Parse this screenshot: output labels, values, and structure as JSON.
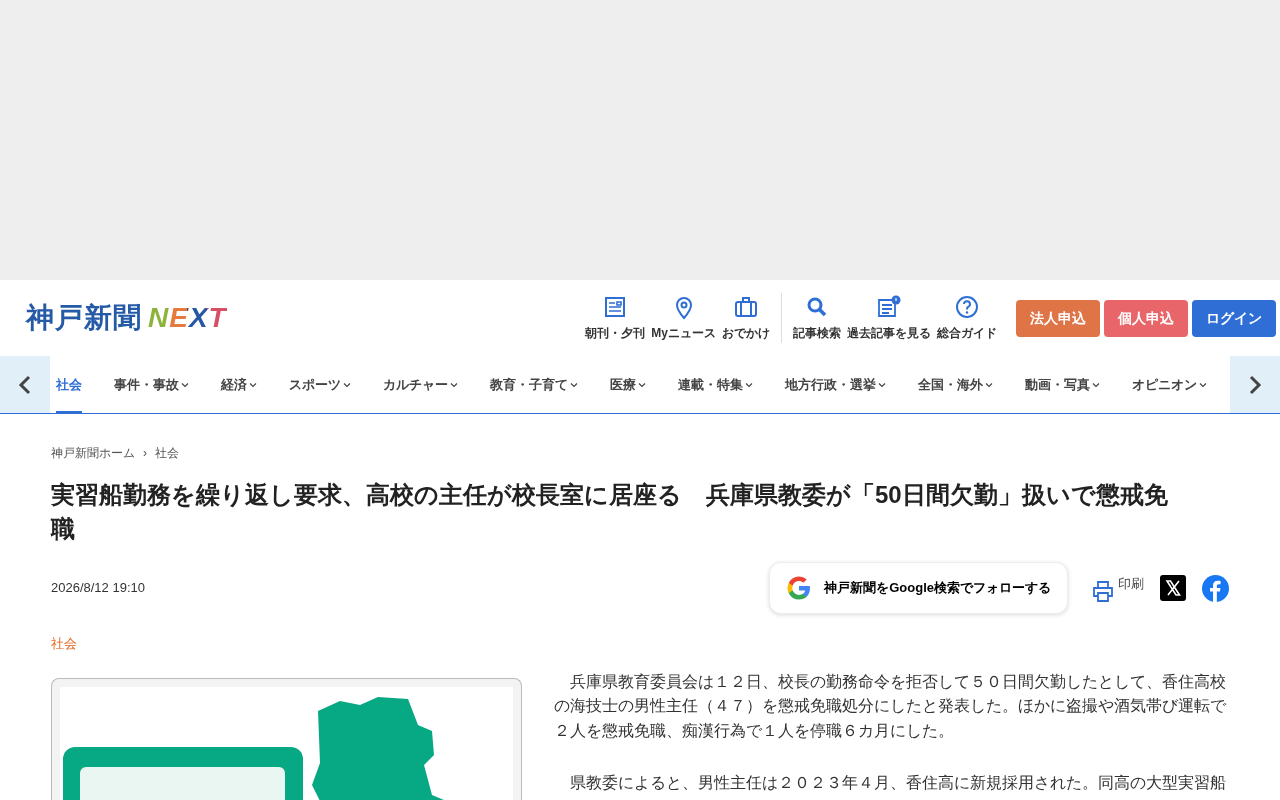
{
  "header": {
    "logo": {
      "text": "神戸新聞",
      "accent": "NEXT"
    },
    "tool_groups": [
      [
        {
          "label": "朝刊・夕刊",
          "kind": "newspaper"
        },
        {
          "label": "Myニュース",
          "kind": "pin"
        },
        {
          "label": "おでかけ",
          "kind": "suitcase"
        }
      ],
      [
        {
          "label": "記事検索",
          "kind": "search"
        },
        {
          "label": "過去記事を見る",
          "kind": "archive"
        },
        {
          "label": "総合ガイド",
          "kind": "help"
        }
      ]
    ],
    "buttons": [
      {
        "label": "法人申込",
        "color": "#df7447"
      },
      {
        "label": "個人申込",
        "color": "#e8666a"
      },
      {
        "label": "ログイン",
        "color": "#2f6fd5"
      }
    ]
  },
  "nav": [
    {
      "label": "社会",
      "selected": true,
      "dropdown": false
    },
    {
      "label": "事件・事故",
      "selected": false,
      "dropdown": true
    },
    {
      "label": "経済",
      "selected": false,
      "dropdown": true
    },
    {
      "label": "スポーツ",
      "selected": false,
      "dropdown": true
    },
    {
      "label": "カルチャー",
      "selected": false,
      "dropdown": true
    },
    {
      "label": "教育・子育て",
      "selected": false,
      "dropdown": true
    },
    {
      "label": "医療",
      "selected": false,
      "dropdown": true
    },
    {
      "label": "連載・特集",
      "selected": false,
      "dropdown": true
    },
    {
      "label": "地方行政・選挙",
      "selected": false,
      "dropdown": true
    },
    {
      "label": "全国・海外",
      "selected": false,
      "dropdown": true
    },
    {
      "label": "動画・写真",
      "selected": false,
      "dropdown": true
    },
    {
      "label": "オピニオン",
      "selected": false,
      "dropdown": true
    }
  ],
  "breadcrumb": {
    "items": [
      "神戸新聞ホーム",
      "社会"
    ],
    "separator": "›"
  },
  "article": {
    "title": "実習船勤務を繰り返し要求、高校の主任が校長室に居座る　兵庫県教委が「50日間欠勤」扱いで懲戒免職",
    "date": "2026/8/12 19:10",
    "follow_button": "神戸新聞をGoogle検索でフォローする",
    "print": "印刷",
    "category": "社会",
    "image": {
      "kind": "picture"
    },
    "paragraphs": [
      "兵庫県教育委員会は１２日、校長の勤務命令を拒否して５０日間欠勤したとして、香住高校の海技士の男性主任（４７）を懲戒免職処分にしたと発表した。ほかに盗撮や酒気帯び運転で２人を懲戒免職、痴漢行為で１人を停職６カ月にした。",
      "県教委によると、男性主任は２０２３年４月、香住高に新規採用された。同高の大型実習船"
    ]
  }
}
